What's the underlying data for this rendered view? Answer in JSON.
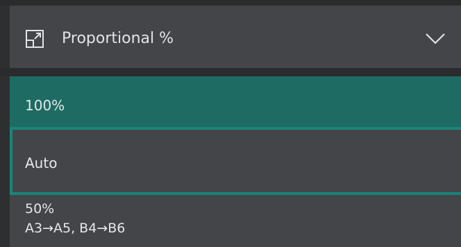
{
  "dropdown": {
    "label": "Proportional %",
    "icon": "resize-icon",
    "expand_icon": "chevron-down-icon"
  },
  "options": [
    {
      "label": "100%",
      "state": "selected"
    },
    {
      "label": "Auto",
      "state": "focused"
    },
    {
      "label": "50%",
      "sublabel": "A3→A5, B4→B6",
      "state": "normal"
    }
  ],
  "colors": {
    "selected_bg": "#1e6b63",
    "focus_border": "#18857a",
    "item_bg": "#444548",
    "text": "#e6e7e9"
  }
}
